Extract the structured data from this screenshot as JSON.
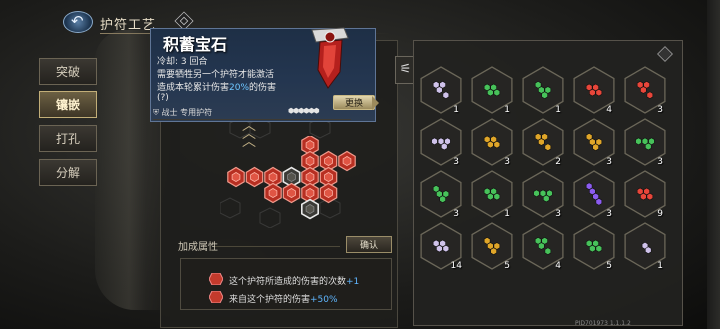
{
  "header": {
    "title": "护符工艺"
  },
  "menu": [
    {
      "label": "突破",
      "active": false
    },
    {
      "label": "镶嵌",
      "active": true
    },
    {
      "label": "打孔",
      "active": false
    },
    {
      "label": "分解",
      "active": false
    }
  ],
  "tooltip": {
    "name": "积蓄宝石",
    "cooldown_label": "冷却:",
    "cooldown_value": "3",
    "cooldown_unit": "回合",
    "desc_line1": "需要牺牲另一个护符才能激活",
    "desc_line2_a": "造成本轮累计伤害",
    "desc_line2_pct": "20%",
    "desc_line2_b": "的伤害",
    "desc_line3": "(?)",
    "swap_label": "更换",
    "dedicated_label": "战士 专用护符"
  },
  "board": {
    "pattern": [
      [
        null,
        "red",
        null
      ],
      [
        null,
        "red",
        "red",
        "red"
      ],
      [
        "red",
        "red",
        "red",
        "empty",
        "red",
        "red"
      ],
      [
        null,
        "red",
        "red",
        "red",
        "red"
      ],
      [
        null,
        null,
        "empty"
      ]
    ]
  },
  "bonus": {
    "label": "加成属性",
    "confirm_label": "确认",
    "line1_text": "这个护符所造成的伤害的次数",
    "line1_value": "+1",
    "line2_text": "来自这个护符的伤害",
    "line2_value": "+50%"
  },
  "inventory": [
    {
      "color": "#cfc2ea",
      "shape": "zig",
      "count": "1"
    },
    {
      "color": "#47c25a",
      "shape": "tri",
      "count": "1"
    },
    {
      "color": "#47c25a",
      "shape": "stair",
      "count": "1"
    },
    {
      "color": "#e8463a",
      "shape": "tri",
      "count": "4"
    },
    {
      "color": "#e8463a",
      "shape": "zig",
      "count": "3"
    },
    {
      "color": "#cfc2ea",
      "shape": "line3",
      "count": "3"
    },
    {
      "color": "#e0a629",
      "shape": "tri",
      "count": "3"
    },
    {
      "color": "#e0a629",
      "shape": "zig",
      "count": "2"
    },
    {
      "color": "#e0a629",
      "shape": "stair",
      "count": "3"
    },
    {
      "color": "#47c25a",
      "shape": "line3",
      "count": "3"
    },
    {
      "color": "#47c25a",
      "shape": "stair",
      "count": "3"
    },
    {
      "color": "#47c25a",
      "shape": "tri",
      "count": "1"
    },
    {
      "color": "#47c25a",
      "shape": "line3",
      "count": "3"
    },
    {
      "color": "#8c5cf0",
      "shape": "diag",
      "count": "3"
    },
    {
      "color": "#e8463a",
      "shape": "tri",
      "count": "9"
    },
    {
      "color": "#cfc2ea",
      "shape": "tri",
      "count": "14"
    },
    {
      "color": "#e0a629",
      "shape": "stair",
      "count": "5"
    },
    {
      "color": "#47c25a",
      "shape": "zig",
      "count": "4"
    },
    {
      "color": "#47c25a",
      "shape": "tri",
      "count": "5"
    },
    {
      "color": "#cfc2ea",
      "shape": "single",
      "count": "1"
    }
  ],
  "footer": {
    "build_id": "PID701973  1.1.1.2"
  },
  "colors": {
    "accent_blue": "#5fb6ff",
    "gem_red": "#d8412f",
    "panel_bg": "#222220"
  }
}
